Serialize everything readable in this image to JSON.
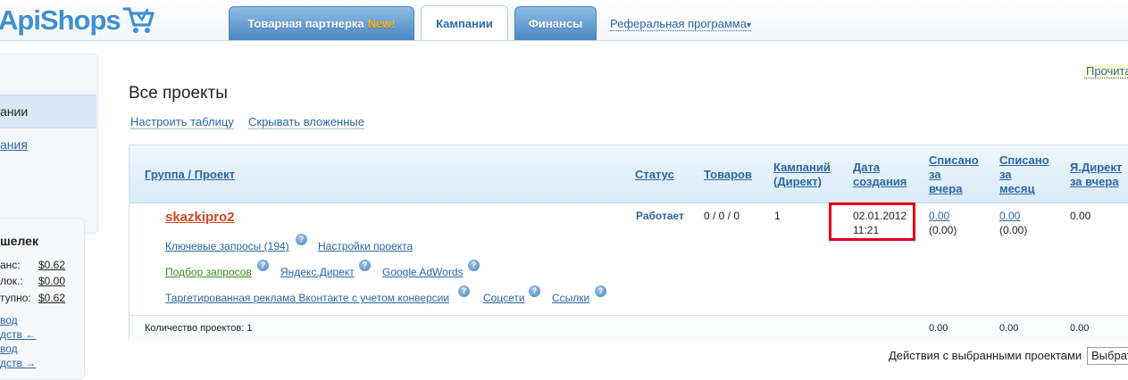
{
  "brand": {
    "logo_text": "ApiShops"
  },
  "nav": {
    "tabs": [
      {
        "label": "Товарная партнерка",
        "badge": "New!"
      },
      {
        "label": "Кампании"
      },
      {
        "label": "Финансы"
      }
    ],
    "referral": {
      "label": "Реферальная программа",
      "caret": "▾"
    }
  },
  "sidebar": {
    "active_item": "ании",
    "link_item": "ания",
    "wallet": {
      "title": "шелек",
      "rows": [
        {
          "label": "анс:",
          "value": "$0.62"
        },
        {
          "label": "лок.:",
          "value": "$0.00"
        },
        {
          "label": "тупно:",
          "value": "$0.62"
        }
      ],
      "links": [
        "вод",
        "дств ←",
        "вод",
        "дств →"
      ]
    }
  },
  "read_link": "Прочита",
  "page": {
    "title": "Все проекты",
    "tools": [
      "Настроить таблицу",
      "Скрывать вложенные"
    ]
  },
  "table": {
    "headers": {
      "group": "Группа / Проект",
      "status": "Статус",
      "goods": "Товаров",
      "campaigns": [
        "Кампаний",
        "(Директ)"
      ],
      "created": [
        "Дата",
        "создания"
      ],
      "yesterday": [
        "Списано",
        "за",
        "вчера"
      ],
      "month": [
        "Списано",
        "за",
        "месяц"
      ],
      "ydirect": [
        "Я.Директ",
        "за вчера"
      ]
    },
    "row": {
      "name": "skazkipro2",
      "links_line1": [
        "Ключевые запросы (194)",
        "Настройки проекта"
      ],
      "links_line2": [
        "Подбор запросов",
        "Яндекс.Директ",
        "Google AdWords"
      ],
      "links_line3": [
        "Таргетированная реклама Вконтакте с учетом конверсии",
        "Соцсети",
        "Ссылки"
      ],
      "status": "Работает",
      "goods": "0 / 0 / 0",
      "campaigns": "1",
      "created_date": "02.01.2012",
      "created_time": "11:21",
      "yesterday": "0.00",
      "yesterday_sub": "(0.00)",
      "month": "0.00",
      "month_sub": "(0.00)",
      "ydirect": "0.00"
    },
    "footer": {
      "count_label": "Количество проектов: 1",
      "yesterday": "0.00",
      "month": "0.00",
      "ydirect": "0.00"
    }
  },
  "actions": {
    "label": "Действия с выбранными проектами",
    "select_value": "Выбрат"
  },
  "help_glyph": "?",
  "colors": {
    "brand_blue": "#3f8fd2",
    "tab_blue": "#4a86c3",
    "link": "#2d66a3",
    "project": "#d4461f",
    "highlight": "#e0001b",
    "new_badge": "#ffb400"
  }
}
